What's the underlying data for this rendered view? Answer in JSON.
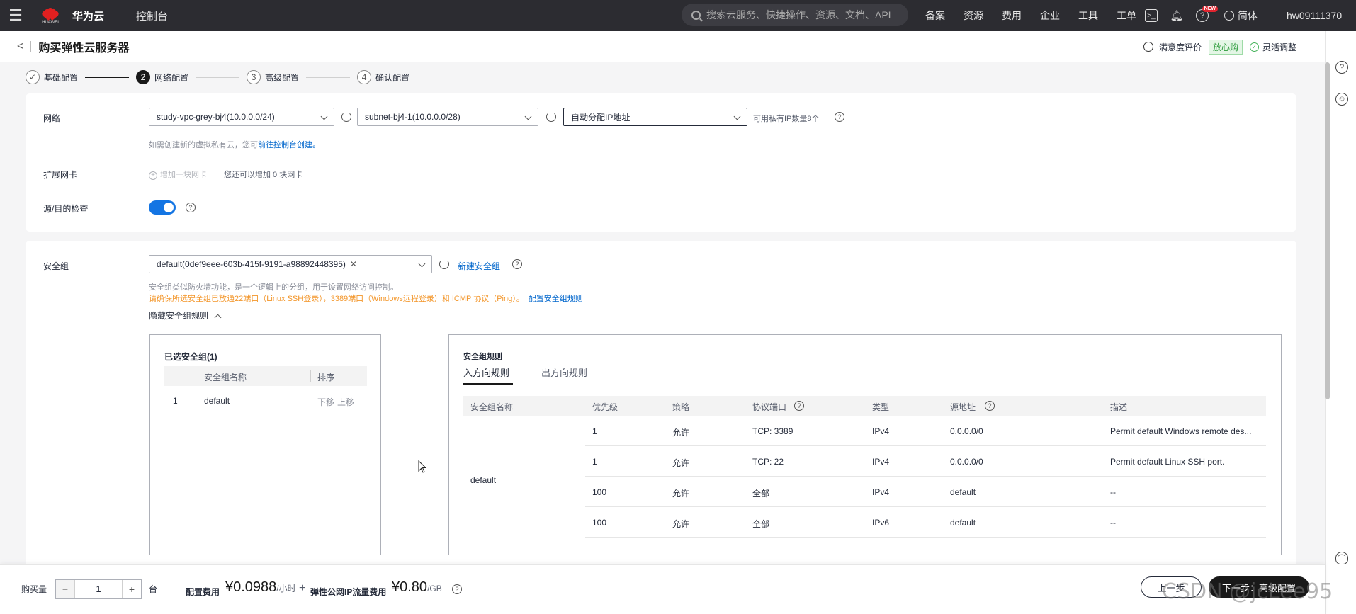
{
  "topnav": {
    "brand": "华为云",
    "logo_word": "HUAWEI",
    "console": "控制台",
    "search_placeholder": "搜索云服务、快捷操作、资源、文档、API",
    "links": [
      "备案",
      "资源",
      "费用",
      "企业",
      "工具",
      "工单"
    ],
    "new_badge": "NEW",
    "lang": "简体",
    "user": "hw09111370"
  },
  "header": {
    "title": "购买弹性云服务器",
    "satisfaction": "满意度评价",
    "safe": "放心购",
    "flexible": "灵活调整"
  },
  "steps": [
    {
      "num": "✓",
      "label": "基础配置"
    },
    {
      "num": "2",
      "label": "网络配置"
    },
    {
      "num": "3",
      "label": "高级配置"
    },
    {
      "num": "4",
      "label": "确认配置"
    }
  ],
  "network": {
    "label": "网络",
    "vpc": "study-vpc-grey-bj4(10.0.0.0/24)",
    "subnet": "subnet-bj4-1(10.0.0.0/28)",
    "ip_mode": "自动分配IP地址",
    "available_ip": "可用私有IP数量8个",
    "hint_prefix": "如需创建新的虚拟私有云，您可",
    "hint_link": "前往控制台创建。"
  },
  "nic": {
    "label": "扩展网卡",
    "add": "增加一块网卡",
    "remaining": "您还可以增加 0 块网卡"
  },
  "src_dst": {
    "label": "源/目的检查"
  },
  "security": {
    "label": "安全组",
    "selected_tag": "default(0def9eee-603b-415f-9191-a98892448395)",
    "new_link": "新建安全组",
    "hint": "安全组类似防火墙功能，是一个逻辑上的分组，用于设置网络访问控制。",
    "warning": "请确保所选安全组已放通22端口（Linux SSH登录），3389端口（Windows远程登录）和 ICMP 协议（Ping）。",
    "config_link": "配置安全组规则",
    "toggle_rules": "隐藏安全组规则"
  },
  "selected_groups": {
    "title": "已选安全组(1)",
    "headers": [
      "安全组名称",
      "排序"
    ],
    "rows": [
      {
        "index": "1",
        "name": "default",
        "down": "下移",
        "up": "上移"
      }
    ]
  },
  "rules": {
    "title": "安全组规则",
    "tabs": [
      "入方向规则",
      "出方向规则"
    ],
    "headers": [
      "安全组名称",
      "优先级",
      "策略",
      "协议端口",
      "类型",
      "源地址",
      "描述"
    ],
    "group_name": "default",
    "rows": [
      {
        "priority": "1",
        "policy": "允许",
        "port": "TCP: 3389",
        "type": "IPv4",
        "source": "0.0.0.0/0",
        "desc": "Permit default Windows remote des..."
      },
      {
        "priority": "1",
        "policy": "允许",
        "port": "TCP: 22",
        "type": "IPv4",
        "source": "0.0.0.0/0",
        "desc": "Permit default Linux SSH port."
      },
      {
        "priority": "100",
        "policy": "允许",
        "port": "全部",
        "type": "IPv4",
        "source": "default",
        "desc": "--"
      },
      {
        "priority": "100",
        "policy": "允许",
        "port": "全部",
        "type": "IPv6",
        "source": "default",
        "desc": "--"
      }
    ]
  },
  "bottom": {
    "qty_label": "购买量",
    "qty": "1",
    "qty_unit": "台",
    "cost_label": "配置费用",
    "cost": "¥0.0988",
    "cost_unit": "/小时",
    "plus": "+",
    "eip_label": "弹性公网IP流量费用",
    "eip_cost": "¥0.80",
    "eip_unit": "/GB",
    "prev": "上一步",
    "next": "下一步：高级配置",
    "watermark": "CSDN @jcLee95"
  }
}
